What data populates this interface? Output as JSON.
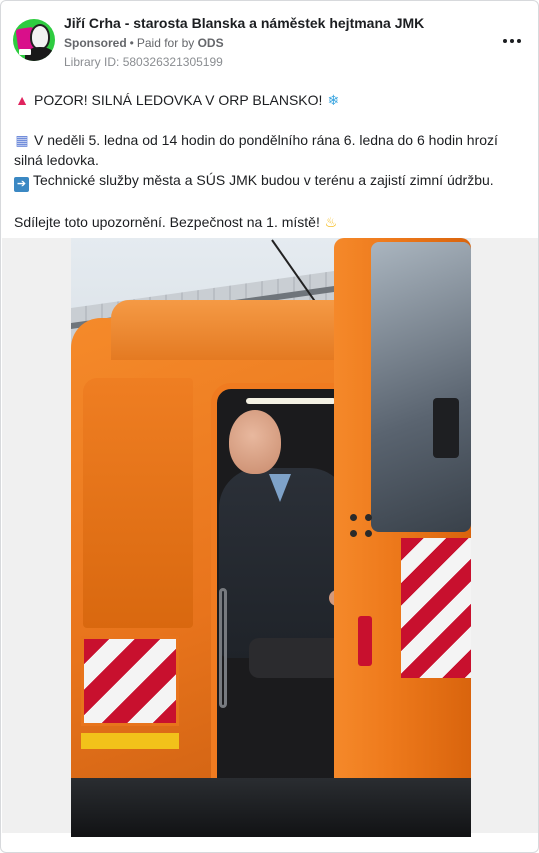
{
  "ad": {
    "author": "Jiří Crha - starosta Blanska a náměstek hejtmana JMK",
    "sponsored_label": "Sponsored",
    "separator": "•",
    "paid_for_prefix": "Paid for by",
    "paid_for_by": "ODS",
    "library_label": "Library ID:",
    "library_id": "580326321305199"
  },
  "post": {
    "line1_icon": "police-light-icon",
    "line1_text": "POZOR! SILNÁ LEDOVKA V ORP BLANSKO!",
    "line1_trailing_icon": "snowflake-icon",
    "line2_icon": "calendar-icon",
    "line2_text": "V neděli 5. ledna od 14 hodin do pondělního rána 6. ledna do 6 hodin hrozí silná ledovka.",
    "line3_icon": "right-arrow-icon",
    "line3_text": "Technické služby města a SÚS JMK budou v terénu a zajistí zimní údržbu.",
    "line4_text": "Sdílejte toto upozornění. Bezpečnost na 1. místě!",
    "line4_trailing_icon": "bell-icon"
  },
  "colors": {
    "author_text": "#1c1e21",
    "meta_text": "#65676b",
    "truck_orange": "#e8741c",
    "avatar_green": "#2ecc40"
  }
}
